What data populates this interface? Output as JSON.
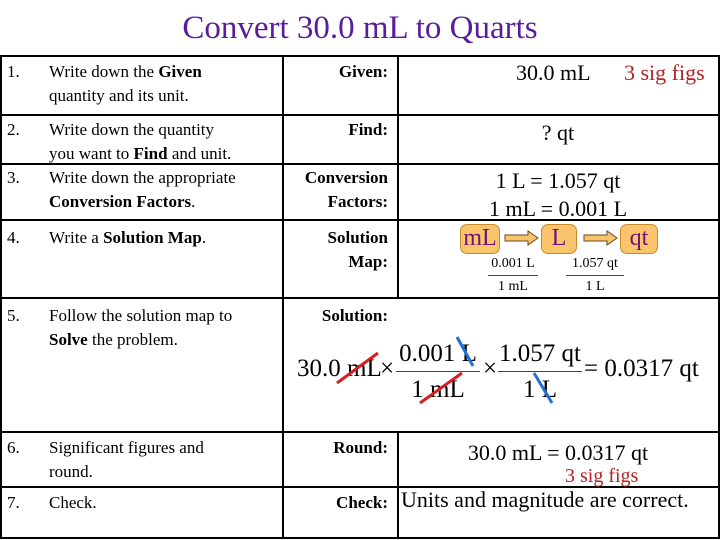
{
  "title": "Convert 30.0 mL to Quarts",
  "steps": [
    {
      "num": "1.",
      "text_html_parts": [
        "Write down the ",
        "Given",
        " quantity and its unit."
      ],
      "label": "Given:"
    },
    {
      "num": "2.",
      "text_html_parts": [
        "Write down the quantity you want to ",
        "Find",
        " and unit."
      ],
      "label": "Find:"
    },
    {
      "num": "3.",
      "text_html_parts": [
        "Write down the appropriate ",
        "Conversion Factors",
        "."
      ],
      "label": "Conversion Factors:"
    },
    {
      "num": "4.",
      "text_html_parts": [
        "Write a ",
        "Solution Map",
        "."
      ],
      "label": "Solution Map:"
    },
    {
      "num": "5.",
      "text_html_parts": [
        "Follow the solution map to ",
        "Solve",
        " the problem."
      ],
      "label": "Solution:"
    },
    {
      "num": "6.",
      "text_html_parts": [
        "Significant figures and round.",
        "",
        ""
      ],
      "label": "Round:"
    },
    {
      "num": "7.",
      "text_html_parts": [
        "Check.",
        "",
        ""
      ],
      "label": "Check:"
    }
  ],
  "given": {
    "value": "30.0 mL",
    "sigfigs": "3 sig figs"
  },
  "find": {
    "value": "? qt"
  },
  "conversion_factors": [
    "1 L = 1.057 qt",
    "1 mL = 0.001 L"
  ],
  "solution_map": {
    "units": [
      "mL",
      "L",
      "qt"
    ],
    "factors": [
      {
        "num": "0.001 L",
        "den": "1 mL"
      },
      {
        "num": "1.057 qt",
        "den": "1 L"
      }
    ]
  },
  "solution": {
    "start": "30.0 ",
    "start_unit": "mL",
    "times": "×",
    "f1_num_val": "0.001 ",
    "f1_num_unit": "L",
    "f1_den_val": "1 ",
    "f1_den_unit": "mL",
    "f2_num": "1.057 qt",
    "f2_den_val": "1 ",
    "f2_den_unit": "L",
    "result": "= 0.0317 qt"
  },
  "round": {
    "value": "30.0 mL = 0.0317 qt",
    "sigfigs": "3 sig figs"
  },
  "check": {
    "value": "Units and magnitude are correct."
  },
  "colors": {
    "title": "#5a1d99",
    "sigfigs": "#b22222",
    "box_fill": "#f9c46b",
    "box_text": "#6b1473",
    "strike_red": "#d81e1e",
    "strike_blue": "#1e6fd8"
  }
}
